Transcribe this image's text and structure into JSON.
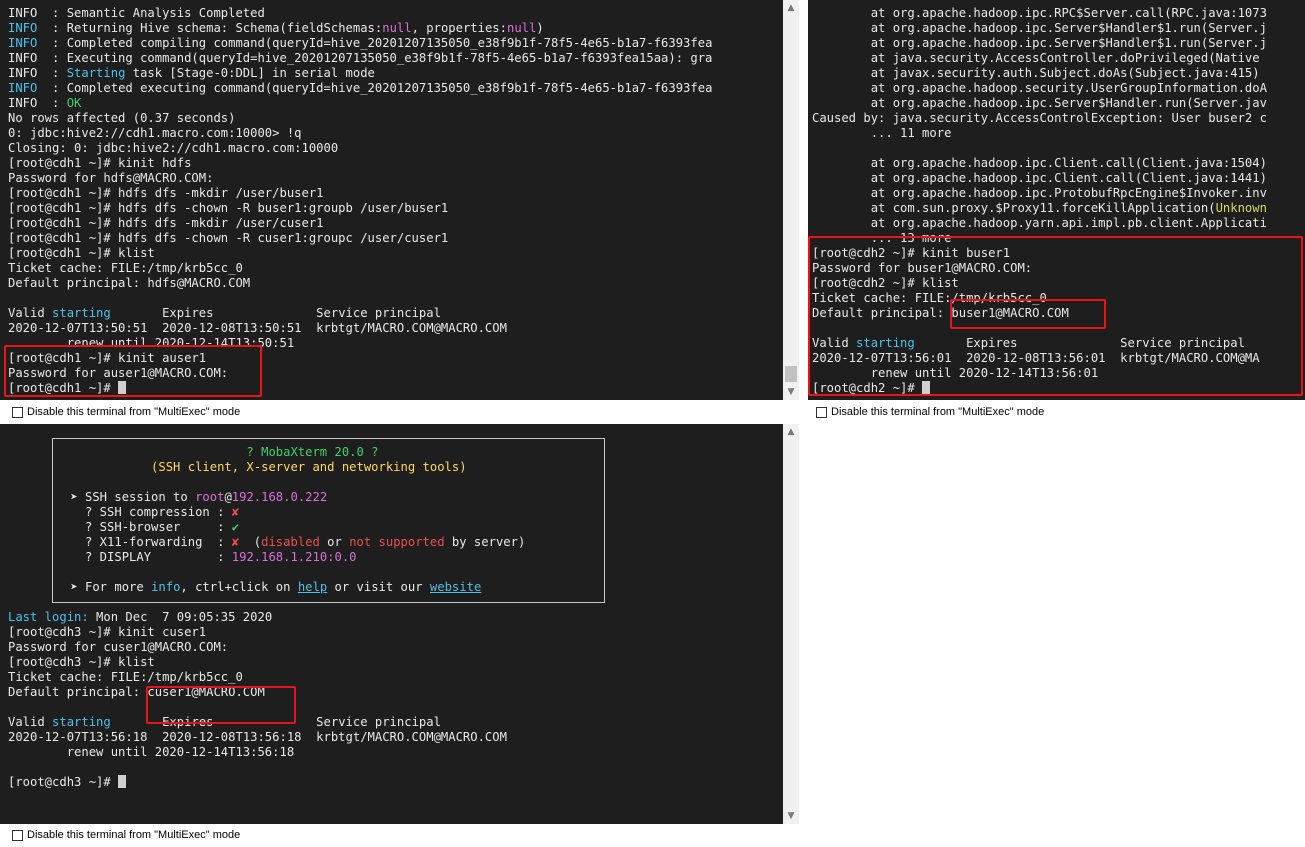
{
  "terminal_cdh1": {
    "lines": [
      [
        {
          "t": "INFO  : Semantic Analysis Completed"
        }
      ],
      [
        {
          "t": "INFO",
          "c": "cyan"
        },
        {
          "t": "  : Returning Hive schema: Schema(fieldSchemas:"
        },
        {
          "t": "null",
          "c": "magenta"
        },
        {
          "t": ", properties:"
        },
        {
          "t": "null",
          "c": "magenta"
        },
        {
          "t": ")"
        }
      ],
      [
        {
          "t": "INFO",
          "c": "cyan"
        },
        {
          "t": "  : Completed compiling command(queryId=hive_20201207135050_e38f9b1f-78f5-4e65-b1a7-f6393fea"
        }
      ],
      [
        {
          "t": "INFO  : Executing command(queryId=hive_20201207135050_e38f9b1f-78f5-4e65-b1a7-f6393fea15aa): gra"
        }
      ],
      [
        {
          "t": "INFO  : "
        },
        {
          "t": "Starting",
          "c": "cyan"
        },
        {
          "t": " task [Stage-0:DDL] in serial mode"
        }
      ],
      [
        {
          "t": "INFO",
          "c": "cyan"
        },
        {
          "t": "  : Completed executing command(queryId=hive_20201207135050_e38f9b1f-78f5-4e65-b1a7-f6393fea"
        }
      ],
      [
        {
          "t": "INFO  : "
        },
        {
          "t": "OK",
          "c": "green"
        }
      ],
      [
        {
          "t": "No rows affected (0.37 seconds)"
        }
      ],
      [
        {
          "t": "0: jdbc:hive2://cdh1.macro.com:10000> !q"
        }
      ],
      [
        {
          "t": "Closing: 0: jdbc:hive2://cdh1.macro.com:10000"
        }
      ],
      [
        {
          "t": "[root@cdh1 ~]# kinit hdfs"
        }
      ],
      [
        {
          "t": "Password for hdfs@MACRO.COM:"
        }
      ],
      [
        {
          "t": "[root@cdh1 ~]# hdfs dfs -mkdir /user/buser1"
        }
      ],
      [
        {
          "t": "[root@cdh1 ~]# hdfs dfs -chown -R buser1:groupb /user/buser1"
        }
      ],
      [
        {
          "t": "[root@cdh1 ~]# hdfs dfs -mkdir /user/cuser1"
        }
      ],
      [
        {
          "t": "[root@cdh1 ~]# hdfs dfs -chown -R cuser1:groupc /user/cuser1"
        }
      ],
      [
        {
          "t": "[root@cdh1 ~]# klist"
        }
      ],
      [
        {
          "t": "Ticket cache: FILE:/tmp/krb5cc_0"
        }
      ],
      [
        {
          "t": "Default principal: hdfs@MACRO.COM"
        }
      ],
      [
        {
          "t": ""
        }
      ],
      [
        {
          "t": "Valid "
        },
        {
          "t": "starting",
          "c": "cyan"
        },
        {
          "t": "       Expires              Service principal"
        }
      ],
      [
        {
          "t": "2020-12-07T13:50:51  2020-12-08T13:50:51  krbtgt/MACRO.COM@MACRO.COM"
        }
      ],
      [
        {
          "t": "        renew until 2020-12-14T13:50:51"
        }
      ],
      [
        {
          "t": "[root@cdh1 ~]# kinit auser1"
        }
      ],
      [
        {
          "t": "Password for auser1@MACRO.COM:"
        }
      ],
      [
        {
          "t": "[root@cdh1 ~]# "
        },
        {
          "cursor": true
        }
      ]
    ]
  },
  "terminal_cdh2": {
    "lines": [
      [
        {
          "t": "        at org.apache.hadoop.ipc.RPC$Server.call(RPC.java:1073"
        }
      ],
      [
        {
          "t": "        at org.apache.hadoop.ipc.Server$Handler$1.run(Server.j"
        }
      ],
      [
        {
          "t": "        at org.apache.hadoop.ipc.Server$Handler$1.run(Server.j"
        }
      ],
      [
        {
          "t": "        at java.security.AccessController.doPrivileged(Native "
        }
      ],
      [
        {
          "t": "        at javax.security.auth.Subject.doAs(Subject.java:415)"
        }
      ],
      [
        {
          "t": "        at org.apache.hadoop.security.UserGroupInformation.doA"
        }
      ],
      [
        {
          "t": "        at org.apache.hadoop.ipc.Server$Handler.run(Server.jav"
        }
      ],
      [
        {
          "t": "Caused by: java.security.AccessControlException: User buser2 c"
        }
      ],
      [
        {
          "t": "        ... 11 more"
        }
      ],
      [
        {
          "t": ""
        }
      ],
      [
        {
          "t": "        at org.apache.hadoop.ipc.Client.call(Client.java:1504)"
        }
      ],
      [
        {
          "t": "        at org.apache.hadoop.ipc.Client.call(Client.java:1441)"
        }
      ],
      [
        {
          "t": "        at org.apache.hadoop.ipc.ProtobufRpcEngine$Invoker.inv"
        }
      ],
      [
        {
          "t": "        at com.sun.proxy.$Proxy11.forceKillApplication("
        },
        {
          "t": "Unknown",
          "c": "yellow"
        }
      ],
      [
        {
          "t": "        at org.apache.hadoop.yarn.api.impl.pb.client.Applicati"
        }
      ],
      [
        {
          "t": "        ... 13 more"
        }
      ],
      [
        {
          "t": "[root@cdh2 ~]# kinit buser1"
        }
      ],
      [
        {
          "t": "Password for buser1@MACRO.COM:"
        }
      ],
      [
        {
          "t": "[root@cdh2 ~]# klist"
        }
      ],
      [
        {
          "t": "Ticket cache: FILE:/tmp/krb5cc_0"
        }
      ],
      [
        {
          "t": "Default principal: buser1@MACRO.COM"
        }
      ],
      [
        {
          "t": ""
        }
      ],
      [
        {
          "t": "Valid "
        },
        {
          "t": "starting",
          "c": "cyan"
        },
        {
          "t": "       Expires              Service principal"
        }
      ],
      [
        {
          "t": "2020-12-07T13:56:01  2020-12-08T13:56:01  krbtgt/MACRO.COM@MA"
        }
      ],
      [
        {
          "t": "        renew until 2020-12-14T13:56:01"
        }
      ],
      [
        {
          "t": "[root@cdh2 ~]# "
        },
        {
          "cursor": true
        }
      ]
    ]
  },
  "banner": {
    "lines": [
      [
        {
          "t": "                         ? MobaXterm 20.0 ?",
          "c": "green"
        }
      ],
      [
        {
          "t": "            (SSH client, X-server and networking tools)",
          "c": "ylw"
        }
      ],
      [
        {
          "t": ""
        }
      ],
      [
        {
          "t": " ➤ SSH session to "
        },
        {
          "t": "root",
          "c": "magenta"
        },
        {
          "t": "@"
        },
        {
          "t": "192.168.0.222",
          "c": "magenta"
        }
      ],
      [
        {
          "t": "   ? SSH compression : "
        },
        {
          "t": "✘",
          "c": "red"
        }
      ],
      [
        {
          "t": "   ? SSH-browser     : "
        },
        {
          "t": "✔",
          "c": "green"
        }
      ],
      [
        {
          "t": "   ? X11-forwarding  : "
        },
        {
          "t": "✘",
          "c": "red"
        },
        {
          "t": "  ("
        },
        {
          "t": "disabled",
          "c": "red"
        },
        {
          "t": " or "
        },
        {
          "t": "not supported",
          "c": "red"
        },
        {
          "t": " by server)"
        }
      ],
      [
        {
          "t": "   ? DISPLAY         : "
        },
        {
          "t": "192.168.1.210:0.0",
          "c": "magenta"
        }
      ],
      [
        {
          "t": ""
        }
      ],
      [
        {
          "t": " ➤ For more "
        },
        {
          "t": "info",
          "c": "cyan"
        },
        {
          "t": ", ctrl+click on "
        },
        {
          "t": "help",
          "c": "link"
        },
        {
          "t": " or visit our "
        },
        {
          "t": "website",
          "c": "link"
        }
      ]
    ]
  },
  "terminal_cdh3": {
    "lines": [
      [
        {
          "t": ""
        }
      ],
      [
        {
          "t": ""
        }
      ],
      [
        {
          "t": ""
        }
      ],
      [
        {
          "t": ""
        }
      ],
      [
        {
          "t": ""
        }
      ],
      [
        {
          "t": ""
        }
      ],
      [
        {
          "t": ""
        }
      ],
      [
        {
          "t": ""
        }
      ],
      [
        {
          "t": ""
        }
      ],
      [
        {
          "t": ""
        }
      ],
      [
        {
          "t": ""
        }
      ],
      [
        {
          "t": ""
        }
      ],
      [
        {
          "t": "Last login:",
          "c": "cyan"
        },
        {
          "t": " Mon Dec  7 09:05:35 2020"
        }
      ],
      [
        {
          "t": "[root@cdh3 ~]# kinit cuser1"
        }
      ],
      [
        {
          "t": "Password for cuser1@MACRO.COM:"
        }
      ],
      [
        {
          "t": "[root@cdh3 ~]# klist"
        }
      ],
      [
        {
          "t": "Ticket cache: FILE:/tmp/krb5cc_0"
        }
      ],
      [
        {
          "t": "Default principal: cuser1@MACRO.COM"
        }
      ],
      [
        {
          "t": ""
        }
      ],
      [
        {
          "t": "Valid "
        },
        {
          "t": "starting",
          "c": "cyan"
        },
        {
          "t": "       Expires              Service principal"
        }
      ],
      [
        {
          "t": "2020-12-07T13:56:18  2020-12-08T13:56:18  krbtgt/MACRO.COM@MACRO.COM"
        }
      ],
      [
        {
          "t": "        renew until 2020-12-14T13:56:18"
        }
      ],
      [
        {
          "t": ""
        }
      ],
      [
        {
          "t": "[root@cdh3 ~]# "
        },
        {
          "cursor": true
        }
      ]
    ]
  },
  "multiexec_label": "Disable this terminal from \"MultiExec\" mode",
  "colors": {
    "terminal_bg": "#1e1e1e",
    "terminal_fg": "#e8e8e8",
    "highlight_box": "#e8141a",
    "cyan": "#4fc1e9",
    "magenta": "#d670d6",
    "green": "#3dd16a",
    "red": "#f04b4b"
  }
}
